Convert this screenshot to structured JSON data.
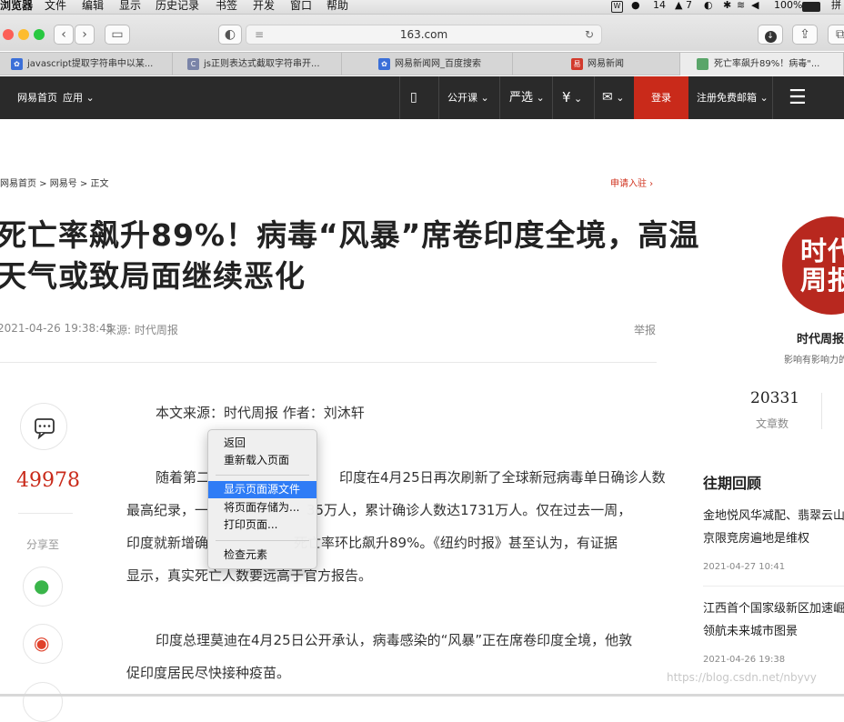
{
  "menubar": {
    "items": [
      "浏览器",
      "文件",
      "编辑",
      "显示",
      "历史记录",
      "书签",
      "开发",
      "窗口",
      "帮助"
    ],
    "status": {
      "wechat_count": "14",
      "notify_count": "7",
      "battery": "100%",
      "input_method": "拼"
    }
  },
  "toolbar": {
    "url": "163.com"
  },
  "tabs": [
    {
      "title": "javascript提取字符串中以某..."
    },
    {
      "title": "js正则表达式截取字符串开..."
    },
    {
      "title": "网易新闻网_百度搜索"
    },
    {
      "title": "网易新闻"
    },
    {
      "title": "死亡率飙升89%！病毒\"..."
    }
  ],
  "sitenav": {
    "home": "网易首页",
    "apps": "应用",
    "open_course": "公开课",
    "yanxuan": "严选",
    "login": "登录",
    "register_mail": "注册免费邮箱"
  },
  "article": {
    "breadcrumb": "网易首页 > 网易号 > 正文",
    "apply": "申请入驻",
    "title_line1": "死亡率飙升89%！病毒“风暴”席卷印度全境，高温",
    "title_line2": "天气或致局面继续恶化",
    "datetime": "2021-04-26 19:38:45",
    "source": "来源: 时代周报",
    "report": "举报",
    "comment_count": "49978",
    "share_label": "分享至",
    "para1": "本文来源：时代周报 作者：刘沐轩",
    "para2_l1a": "随着第二",
    "para2_l1b": "印度在4月25日再次刷新了全球新冠病毒单日确诊人数",
    "para2_l2a": "最高纪录，一",
    "para2_l2b": "35万人，累计确诊人数达1731万人。仅在过去一周，",
    "para2_l3a": "印度就新增确",
    "para2_l3b": "死亡率环比飙升89%。《纽约时报》甚至认为，有证据",
    "para2_l4": "显示，真实死亡人数要远高于官方报告。",
    "para3_l1": "印度总理莫迪在4月25日公开承认，病毒感染的“风暴”正在席卷印度全境，他敦",
    "para3_l2": "促印度居民尽快接种疫苗。"
  },
  "sidebar": {
    "logo_line1": "时代",
    "logo_line2": "周报",
    "name": "时代周报",
    "slogan": "影响有影响力的",
    "article_count": "20331",
    "article_count_label": "文章数",
    "past_title": "往期回顾",
    "items": [
      {
        "line1": "金地悦风华减配、翡翠云山",
        "line2": "京限竞房遍地是维权",
        "date": "2021-04-27 10:41"
      },
      {
        "line1": "江西首个国家级新区加速崛",
        "line2": "领航未来城市图景",
        "date": "2021-04-26 19:38"
      }
    ]
  },
  "context_menu": {
    "items": [
      {
        "label": "返回"
      },
      {
        "label": "重新载入页面"
      },
      {
        "label": "显示页面源文件"
      },
      {
        "label": "将页面存储为..."
      },
      {
        "label": "打印页面..."
      },
      {
        "label": "检查元素"
      }
    ],
    "highlighted_index": 2
  },
  "watermark": "https://blog.csdn.net/nbyvy",
  "colors": {
    "accent_red": "#c92a1a",
    "nav_bg": "#2a2a2a",
    "menu_highlight": "#2f7cf6"
  }
}
